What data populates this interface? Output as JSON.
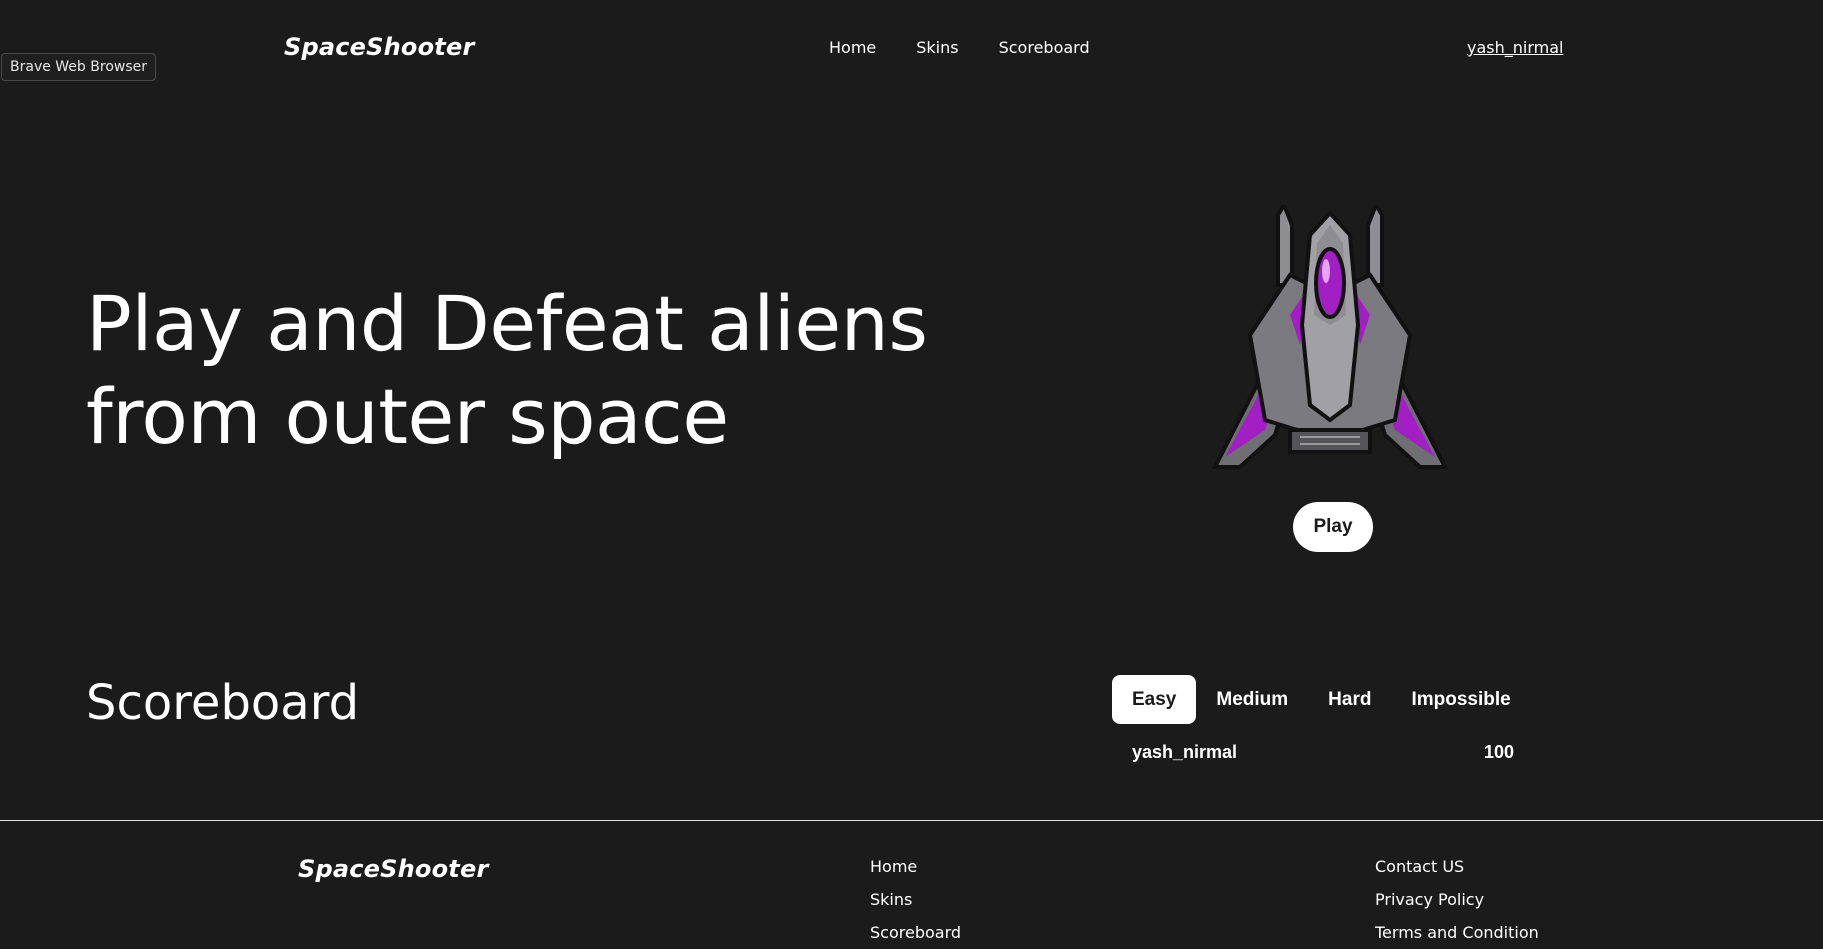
{
  "tooltip": {
    "text": "Brave Web Browser"
  },
  "header": {
    "brand": "SpaceShooter",
    "nav": [
      "Home",
      "Skins",
      "Scoreboard"
    ],
    "user": "yash_nirmal"
  },
  "hero": {
    "title_line1": "Play and Defeat aliens",
    "title_line2": "from outer space",
    "ship_icon": "spaceship-icon",
    "play_label": "Play"
  },
  "scoreboard": {
    "title": "Scoreboard",
    "tabs": [
      "Easy",
      "Medium",
      "Hard",
      "Impossible"
    ],
    "active_tab": "Easy",
    "rows": [
      {
        "name": "yash_nirmal",
        "score": "100"
      }
    ]
  },
  "footer": {
    "brand": "SpaceShooter",
    "links_col1": [
      "Home",
      "Skins",
      "Scoreboard"
    ],
    "links_col2": [
      "Contact US",
      "Privacy Policy",
      "Terms and Condition"
    ]
  },
  "colors": {
    "background": "#1b1b1c",
    "accent": "#a21fc4",
    "text": "#ffffff"
  }
}
